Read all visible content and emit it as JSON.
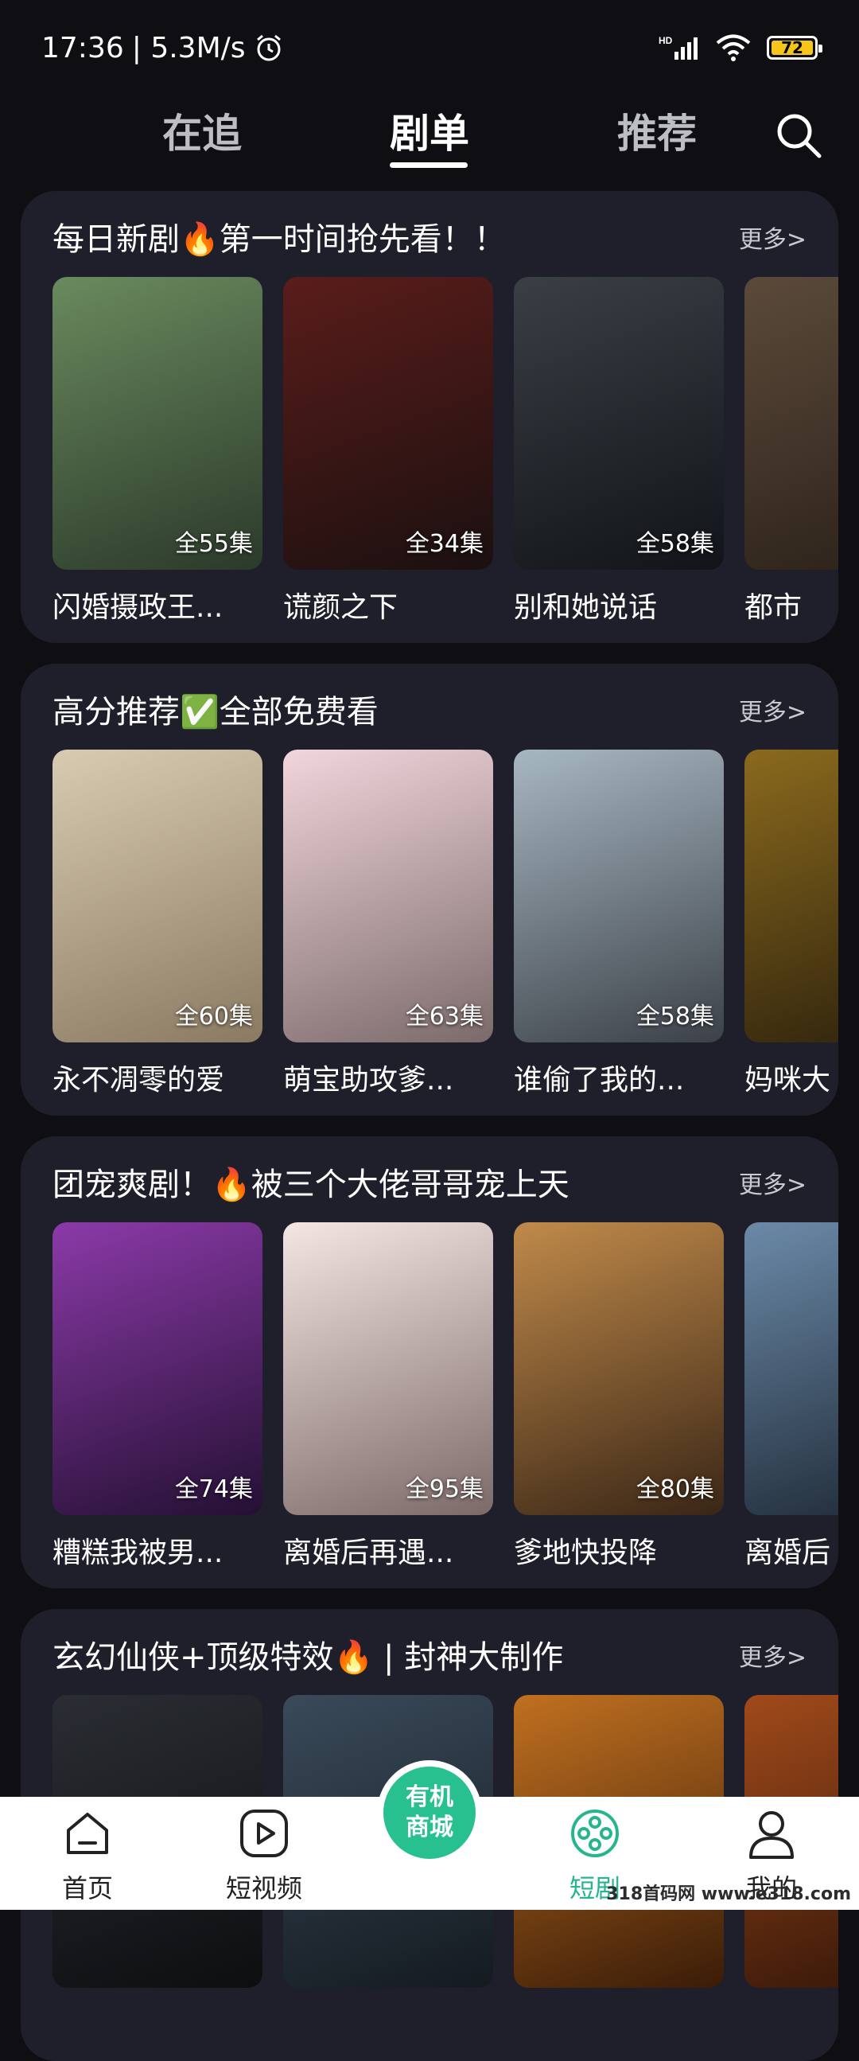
{
  "status": {
    "time": "17:36",
    "speed": "| 5.3M/s",
    "battery": "72"
  },
  "tabs": [
    "在追",
    "剧单",
    "推荐"
  ],
  "sections": [
    {
      "title": "每日新剧🔥第一时间抢先看！！",
      "more": "更多>",
      "cards": [
        {
          "title": "闪婚摄政王...",
          "episodes": "全55集",
          "c1": "#6a8a5e",
          "c2": "#2b3a2a"
        },
        {
          "title": "谎颜之下",
          "episodes": "全34集",
          "c1": "#5a1d1a",
          "c2": "#1b1010"
        },
        {
          "title": "别和她说话",
          "episodes": "全58集",
          "c1": "#3a3f45",
          "c2": "#111418"
        },
        {
          "title": "都市",
          "episodes": "",
          "c1": "#5b4a3a",
          "c2": "#2a2018"
        }
      ]
    },
    {
      "title": "高分推荐✅全部免费看",
      "more": "更多>",
      "cards": [
        {
          "title": "永不凋零的爱",
          "episodes": "全60集",
          "c1": "#d9cbb2",
          "c2": "#8a7a62"
        },
        {
          "title": "萌宝助攻爹...",
          "episodes": "全63集",
          "c1": "#f1d6dc",
          "c2": "#7c6a6a"
        },
        {
          "title": "谁偷了我的...",
          "episodes": "全58集",
          "c1": "#a7b7c2",
          "c2": "#3c4148"
        },
        {
          "title": "妈咪大",
          "episodes": "",
          "c1": "#8b6a1e",
          "c2": "#2b200c"
        }
      ]
    },
    {
      "title": "团宠爽剧！🔥被三个大佬哥哥宠上天",
      "more": "更多>",
      "cards": [
        {
          "title": "糟糕我被男...",
          "episodes": "全74集",
          "c1": "#8b3aa8",
          "c2": "#241033"
        },
        {
          "title": "离婚后再遇...",
          "episodes": "全95集",
          "c1": "#f4e6e2",
          "c2": "#7c6a68"
        },
        {
          "title": "爹地快投降",
          "episodes": "全80集",
          "c1": "#c08a4a",
          "c2": "#3a2616"
        },
        {
          "title": "离婚后",
          "episodes": "",
          "c1": "#6b8aa8",
          "c2": "#1c2632"
        }
      ]
    },
    {
      "title": "玄幻仙侠+顶级特效🔥 | 封神大制作",
      "more": "更多>",
      "cards": [
        {
          "title": "",
          "episodes": "",
          "c1": "#2a2d33",
          "c2": "#0d0e10"
        },
        {
          "title": "",
          "episodes": "",
          "c1": "#3a4a5a",
          "c2": "#141a20"
        },
        {
          "title": "",
          "episodes": "",
          "c1": "#c07020",
          "c2": "#3a1c08"
        },
        {
          "title": "",
          "episodes": "",
          "c1": "#a04a1a",
          "c2": "#301408"
        }
      ]
    }
  ],
  "mall": {
    "line1": "有机",
    "line2": "商城"
  },
  "nav": [
    "首页",
    "短视频",
    "短剧",
    "我的"
  ],
  "watermark": "318首码网 www.e318.com"
}
